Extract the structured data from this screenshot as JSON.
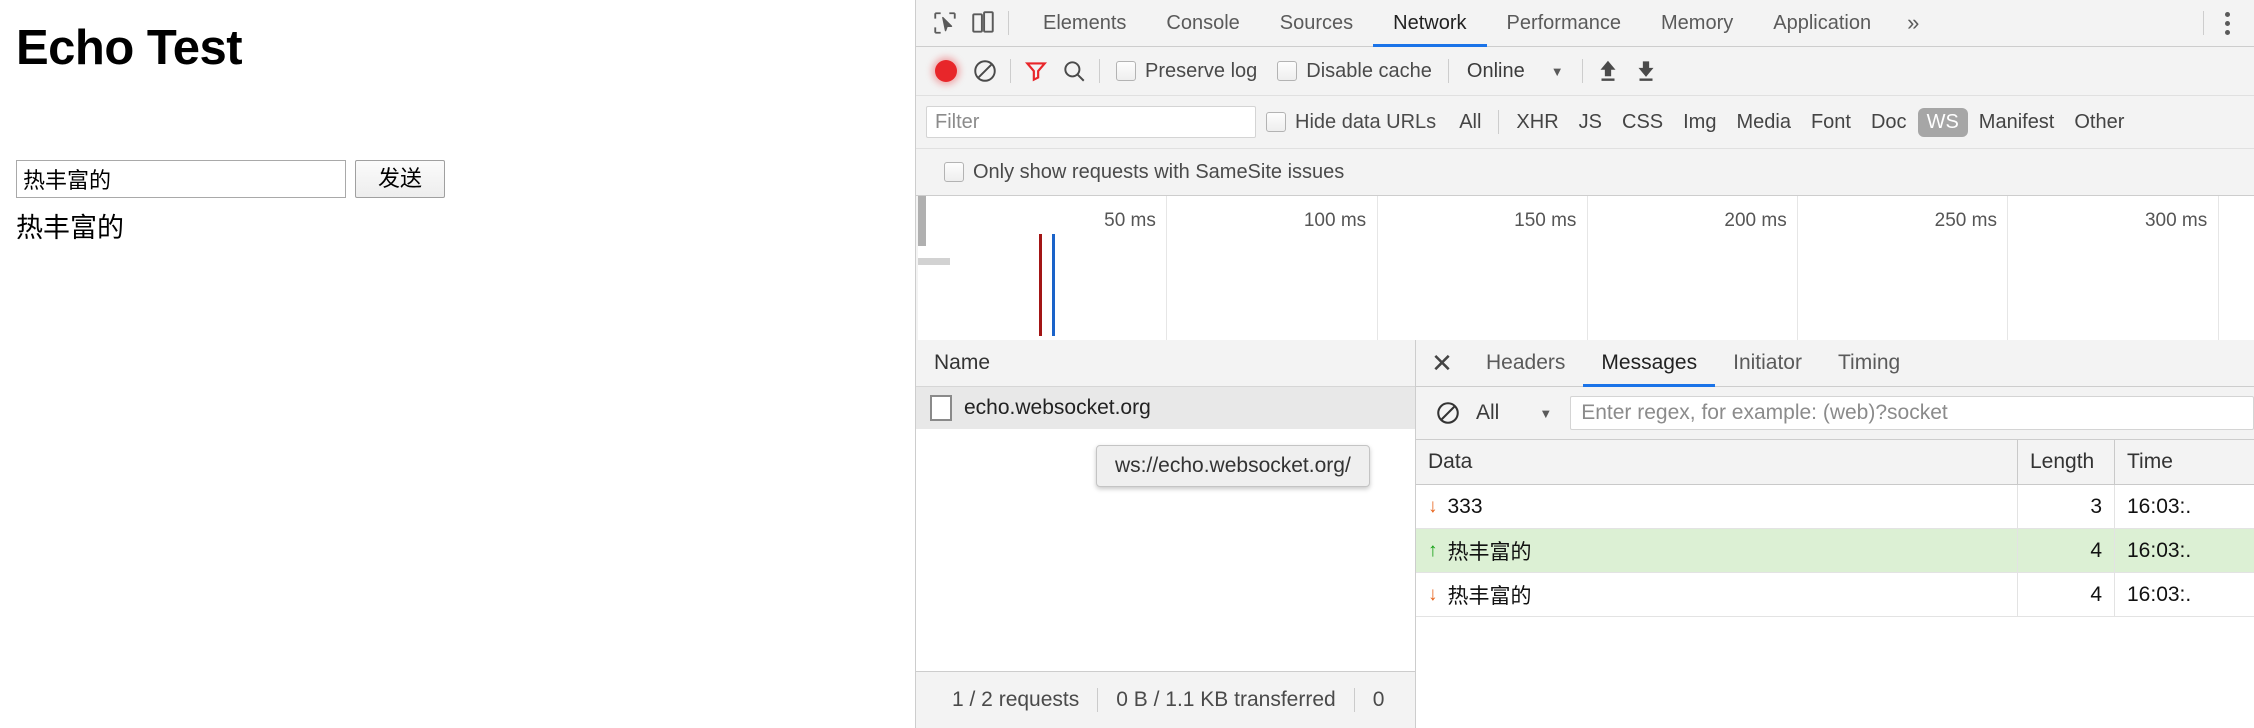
{
  "page": {
    "title": "Echo Test",
    "input_value": "热丰富的",
    "input_placeholder": "",
    "send_label": "发送",
    "output_text": "热丰富的"
  },
  "devtools": {
    "main_tabs": [
      {
        "label": "Elements",
        "active": false
      },
      {
        "label": "Console",
        "active": false
      },
      {
        "label": "Sources",
        "active": false
      },
      {
        "label": "Network",
        "active": true
      },
      {
        "label": "Performance",
        "active": false
      },
      {
        "label": "Memory",
        "active": false
      },
      {
        "label": "Application",
        "active": false
      }
    ],
    "more_tabs_label": "»",
    "icons": {
      "inspect": "inspect-cursor-icon",
      "device": "device-toolbar-icon",
      "record": "record-icon",
      "clear": "clear-icon",
      "filter": "filter-funnel-icon",
      "search": "search-icon",
      "import": "import-har-icon",
      "export": "export-har-icon",
      "kebab": "more-options-icon"
    },
    "netbar": {
      "preserve_log_label": "Preserve log",
      "preserve_log_checked": false,
      "disable_cache_label": "Disable cache",
      "disable_cache_checked": false,
      "throttling_value": "Online"
    },
    "filterbar": {
      "filter_placeholder": "Filter",
      "filter_value": "",
      "hide_data_urls_label": "Hide data URLs",
      "hide_data_urls_checked": false,
      "types": [
        {
          "label": "All",
          "selected": false
        },
        {
          "label": "XHR",
          "selected": false
        },
        {
          "label": "JS",
          "selected": false
        },
        {
          "label": "CSS",
          "selected": false
        },
        {
          "label": "Img",
          "selected": false
        },
        {
          "label": "Media",
          "selected": false
        },
        {
          "label": "Font",
          "selected": false
        },
        {
          "label": "Doc",
          "selected": false
        },
        {
          "label": "WS",
          "selected": true
        },
        {
          "label": "Manifest",
          "selected": false
        },
        {
          "label": "Other",
          "selected": false
        }
      ]
    },
    "samesite": {
      "label": "Only show requests with SameSite issues",
      "checked": false
    },
    "overview": {
      "ticks": [
        "50 ms",
        "100 ms",
        "150 ms",
        "200 ms",
        "250 ms",
        "300 ms"
      ],
      "event_lines": [
        {
          "name": "dom-content-loaded",
          "color": "#a31515",
          "ms": 21
        },
        {
          "name": "load",
          "color": "#1a63c9",
          "ms": 24
        }
      ],
      "max_ms": 330
    },
    "request_list": {
      "column_header": "Name",
      "rows": [
        {
          "name": "echo.websocket.org",
          "selected": true
        }
      ],
      "tooltip": "ws://echo.websocket.org/"
    },
    "status_bar": {
      "requests": "1 / 2 requests",
      "transferred": "0 B / 1.1 KB transferred",
      "resources": "0"
    },
    "details": {
      "close_label": "✕",
      "tabs": [
        {
          "label": "Headers",
          "active": false
        },
        {
          "label": "Messages",
          "active": true
        },
        {
          "label": "Initiator",
          "active": false
        },
        {
          "label": "Timing",
          "active": false
        }
      ],
      "messages_bar": {
        "filter_value": "All",
        "regex_placeholder": "Enter regex, for example: (web)?socket",
        "regex_value": ""
      },
      "table": {
        "columns": [
          "Data",
          "Length",
          "Time"
        ],
        "rows": [
          {
            "direction": "in",
            "arrow": "↓",
            "data": "333",
            "length": "3",
            "time": "16:03:."
          },
          {
            "direction": "out",
            "arrow": "↑",
            "data": "热丰富的",
            "length": "4",
            "time": "16:03:."
          },
          {
            "direction": "in",
            "arrow": "↓",
            "data": "热丰富的",
            "length": "4",
            "time": "16:03:."
          }
        ]
      }
    }
  }
}
